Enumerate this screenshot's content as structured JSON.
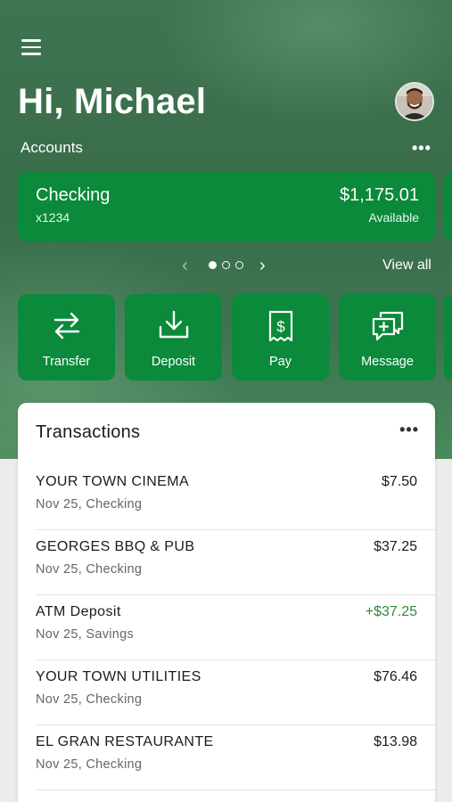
{
  "header": {
    "greeting": "Hi, Michael",
    "accounts_label": "Accounts",
    "accounts_more": "•••"
  },
  "account_card": {
    "name": "Checking",
    "number": "x1234",
    "balance": "$1,175.01",
    "balance_label": "Available"
  },
  "pager": {
    "view_all": "View all",
    "prev": "‹",
    "next": "›"
  },
  "actions": [
    {
      "label": "Transfer",
      "icon": "transfer-icon"
    },
    {
      "label": "Deposit",
      "icon": "deposit-icon"
    },
    {
      "label": "Pay",
      "icon": "bill-icon"
    },
    {
      "label": "Message",
      "icon": "message-icon"
    }
  ],
  "transactions": {
    "title": "Transactions",
    "more": "•••",
    "items": [
      {
        "merchant": "YOUR TOWN CINEMA",
        "meta": "Nov 25, Checking",
        "amount": "$7.50"
      },
      {
        "merchant": "GEORGES BBQ & PUB",
        "meta": "Nov 25, Checking",
        "amount": "$37.25"
      },
      {
        "merchant": "ATM Deposit",
        "meta": "Nov 25, Savings",
        "amount": "+$37.25"
      },
      {
        "merchant": "YOUR TOWN UTILITIES",
        "meta": "Nov 25, Checking",
        "amount": "$76.46"
      },
      {
        "merchant": "EL GRAN RESTAURANTE",
        "meta": "Nov 25, Checking",
        "amount": "$13.98"
      }
    ]
  },
  "colors": {
    "brand_green": "#0a8a3a",
    "positive_amount": "#2e8b3a"
  }
}
